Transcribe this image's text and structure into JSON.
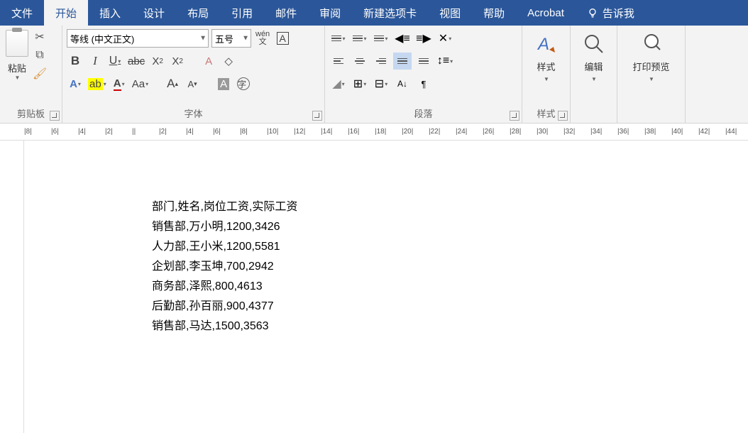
{
  "tabs": {
    "file": "文件",
    "home": "开始",
    "insert": "插入",
    "design": "设计",
    "layout": "布局",
    "references": "引用",
    "mailings": "邮件",
    "review": "审阅",
    "newtab": "新建选项卡",
    "view": "视图",
    "help": "帮助",
    "acrobat": "Acrobat",
    "tellme": "告诉我"
  },
  "clipboard": {
    "paste": "粘贴",
    "label": "剪贴板"
  },
  "font": {
    "name": "等线 (中文正文)",
    "size": "五号",
    "ruby": "wén",
    "label": "字体"
  },
  "paragraph": {
    "label": "段落"
  },
  "styles": {
    "btn": "样式",
    "label": "样式"
  },
  "editing": {
    "btn": "编辑"
  },
  "preview": {
    "btn": "打印预览"
  },
  "ruler": [
    "8",
    "6",
    "4",
    "2",
    "",
    "2",
    "4",
    "6",
    "8",
    "10",
    "12",
    "14",
    "16",
    "18",
    "20",
    "22",
    "24",
    "26",
    "28",
    "30",
    "32",
    "34",
    "36",
    "38",
    "40",
    "42",
    "44"
  ],
  "document": {
    "lines": [
      "部门,姓名,岗位工资,实际工资",
      "销售部,万小明,1200,3426",
      "人力部,王小米,1200,5581",
      "企划部,李玉坤,700,2942",
      "商务部,泽熙,800,4613",
      "后勤部,孙百丽,900,4377",
      "销售部,马达,1500,3563"
    ]
  }
}
